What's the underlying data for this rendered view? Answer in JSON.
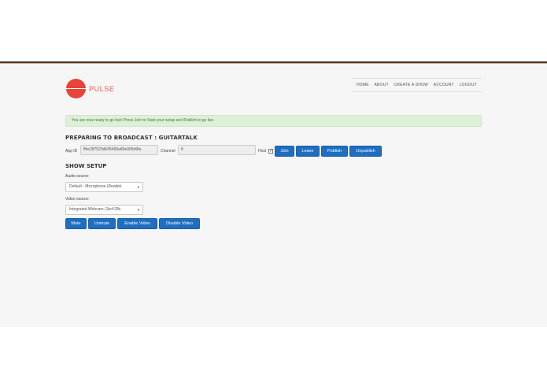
{
  "brand": {
    "name": "PULSE",
    "accent": "#e8443a"
  },
  "nav": [
    "HOME",
    "ABOUT",
    "CREATE A SHOW",
    "ACCOUNT",
    "LOGOUT"
  ],
  "alert": {
    "text": "You are now ready to go live! Press Join to Start your setup and Publish to go live."
  },
  "broadcast": {
    "title": "PREPARING TO BROADCAST : GUITARTALK",
    "app_id_label": "App ID",
    "app_id_value": "ffbc287523d645499a89e995d9fa",
    "channel_label": "Channel",
    "channel_value": "8",
    "host_label": "Host",
    "host_checked": true,
    "buttons": {
      "join": "Join",
      "leave": "Leave",
      "publish": "Publish",
      "unpublish": "Unpublish"
    }
  },
  "setup": {
    "title": "SHOW SETUP",
    "audio_label": "Audio source:",
    "audio_value": "Default - Microphone (Realtek",
    "video_label": "Video source:",
    "video_value": "Integrated Webcam (1bcf:28c",
    "buttons": {
      "mute": "Mute",
      "unmute": "Unmute",
      "enable_video": "Enable Video",
      "disable_video": "Disable Video"
    }
  },
  "colors": {
    "button": "#1f6ec0",
    "alert_bg": "#dff0d8",
    "alert_text": "#3c763d",
    "page_bg": "#f6f6f6"
  }
}
